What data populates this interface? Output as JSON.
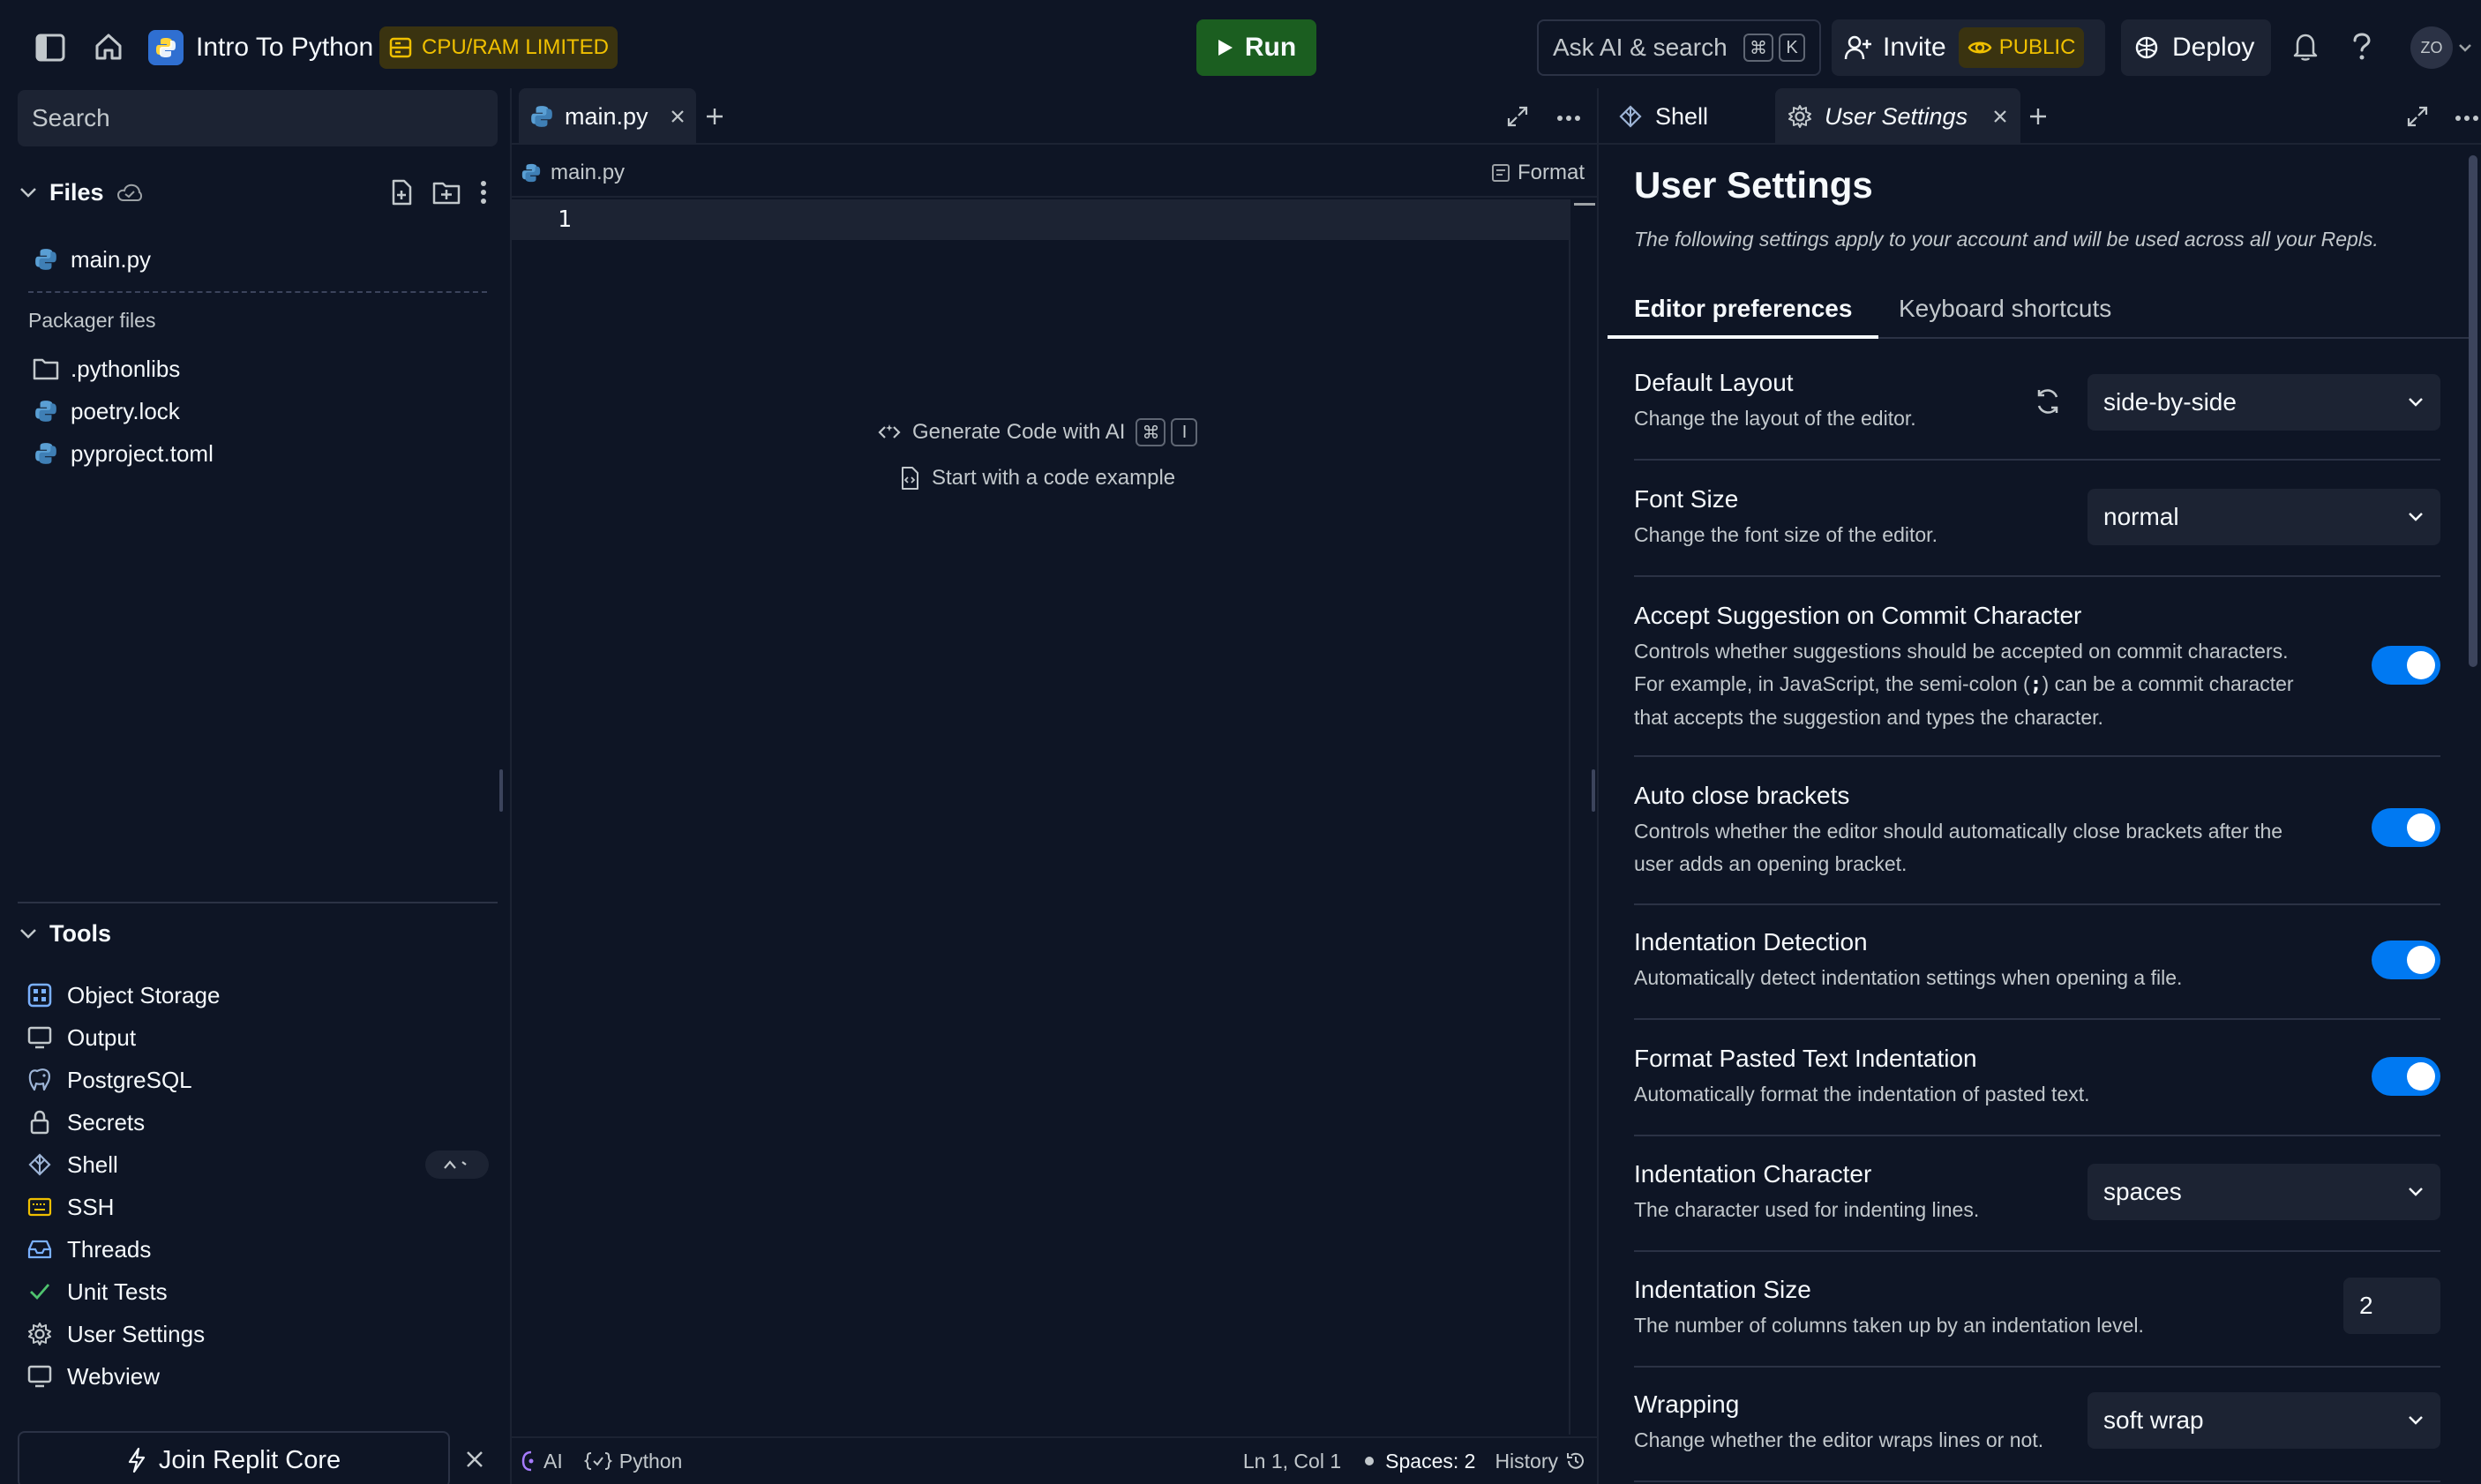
{
  "header": {
    "repl_name": "Intro To Python",
    "resource_badge": "CPU/RAM LIMITED",
    "run_label": "Run",
    "search_placeholder": "Ask AI & search",
    "search_kbd_1": "⌘",
    "search_kbd_2": "K",
    "invite_label": "Invite",
    "visibility_label": "PUBLIC",
    "deploy_label": "Deploy",
    "avatar_initials": "ZO"
  },
  "sidebar": {
    "search_placeholder": "Search",
    "files_label": "Files",
    "files": [
      {
        "name": "main.py"
      }
    ],
    "packager_label": "Packager files",
    "packager_files": [
      {
        "name": ".pythonlibs"
      },
      {
        "name": "poetry.lock"
      },
      {
        "name": "pyproject.toml"
      }
    ],
    "tools_label": "Tools",
    "tools": [
      {
        "name": "Object Storage"
      },
      {
        "name": "Output"
      },
      {
        "name": "PostgreSQL"
      },
      {
        "name": "Secrets"
      },
      {
        "name": "Shell"
      },
      {
        "name": "SSH"
      },
      {
        "name": "Threads"
      },
      {
        "name": "Unit Tests"
      },
      {
        "name": "User Settings"
      },
      {
        "name": "Webview"
      }
    ],
    "join_core_label": "Join Replit Core"
  },
  "editor": {
    "tab_label": "main.py",
    "breadcrumb": "main.py",
    "format_label": "Format",
    "line_number": "1",
    "generate_label": "Generate Code with AI",
    "generate_kbd_1": "⌘",
    "generate_kbd_2": "I",
    "example_label": "Start with a code example",
    "status": {
      "ai_label": "AI",
      "language": "Python",
      "cursor": "Ln 1, Col 1",
      "spaces": "Spaces: 2",
      "history": "History"
    }
  },
  "right_panel": {
    "tabs": [
      {
        "label": "Shell"
      },
      {
        "label": "User Settings"
      }
    ],
    "title": "User Settings",
    "subtitle": "The following settings apply to your account and will be used across all your Repls.",
    "subtabs": [
      {
        "label": "Editor preferences"
      },
      {
        "label": "Keyboard shortcuts"
      }
    ],
    "settings": {
      "default_layout": {
        "title": "Default Layout",
        "desc": "Change the layout of the editor.",
        "value": "side-by-side"
      },
      "font_size": {
        "title": "Font Size",
        "desc": "Change the font size of the editor.",
        "value": "normal"
      },
      "accept_suggestion": {
        "title": "Accept Suggestion on Commit Character",
        "desc_1": "Controls whether suggestions should be accepted on commit characters.",
        "desc_2a": "For example, in JavaScript, the semi-colon (",
        "desc_code": ";",
        "desc_2b": ") can be a commit character",
        "desc_3": "that accepts the suggestion and types the character."
      },
      "auto_close": {
        "title": "Auto close brackets",
        "desc_1": "Controls whether the editor should automatically close brackets after the",
        "desc_2": "user adds an opening bracket."
      },
      "indent_detection": {
        "title": "Indentation Detection",
        "desc": "Automatically detect indentation settings when opening a file."
      },
      "format_pasted": {
        "title": "Format Pasted Text Indentation",
        "desc": "Automatically format the indentation of pasted text."
      },
      "indent_char": {
        "title": "Indentation Character",
        "desc": "The character used for indenting lines.",
        "value": "spaces"
      },
      "indent_size": {
        "title": "Indentation Size",
        "desc": "The number of columns taken up by an indentation level.",
        "value": "2"
      },
      "wrapping": {
        "title": "Wrapping",
        "desc": "Change whether the editor wraps lines or not.",
        "value": "soft wrap"
      }
    }
  },
  "colors": {
    "background": "#0e1525",
    "surface": "#1c2333",
    "run_green": "#1b5e20",
    "badge_yellow": "#f0c000",
    "toggle_blue": "#0079f2"
  }
}
